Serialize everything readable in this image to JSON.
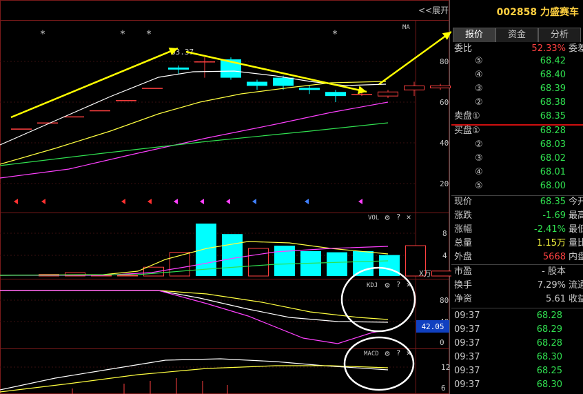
{
  "header": {
    "code": "002858",
    "name": "力盛赛车",
    "expand_label": "<<展开"
  },
  "tabs": [
    "报价",
    "资金",
    "分析"
  ],
  "ratio": {
    "label": "委比",
    "value": "52.33%",
    "tail": "委差"
  },
  "asks": [
    {
      "label": "⑤",
      "price": "68.42"
    },
    {
      "label": "④",
      "price": "68.40"
    },
    {
      "label": "③",
      "price": "68.39"
    },
    {
      "label": "②",
      "price": "68.38"
    },
    {
      "label": "卖盘①",
      "price": "68.35"
    }
  ],
  "bids": [
    {
      "label": "买盘①",
      "price": "68.28"
    },
    {
      "label": "②",
      "price": "68.03"
    },
    {
      "label": "③",
      "price": "68.02"
    },
    {
      "label": "④",
      "price": "68.01"
    },
    {
      "label": "⑤",
      "price": "68.00"
    }
  ],
  "quote": [
    {
      "label": "现价",
      "value": "68.35",
      "tail": "今开",
      "cls": "dn"
    },
    {
      "label": "涨跌",
      "value": "-1.69",
      "tail": "最高",
      "cls": "dn"
    },
    {
      "label": "涨幅",
      "value": "-2.41%",
      "tail": "最低",
      "cls": "dn"
    },
    {
      "label": "总量",
      "value": "1.15万",
      "tail": "量比",
      "cls": "yl"
    },
    {
      "label": "外盘",
      "value": "5668",
      "tail": "内盘",
      "cls": "up"
    }
  ],
  "fund": [
    {
      "label": "市盈",
      "value": "- 股本"
    },
    {
      "label": "换手",
      "value": "7.29%",
      "tail": "流通"
    },
    {
      "label": "净资",
      "value": "5.61",
      "tail": "收益(一"
    }
  ],
  "ticks": [
    {
      "time": "09:37",
      "price": "68.28"
    },
    {
      "time": "09:37",
      "price": "68.29"
    },
    {
      "time": "09:37",
      "price": "68.28"
    },
    {
      "time": "09:37",
      "price": "68.30"
    },
    {
      "time": "09:37",
      "price": "68.25"
    },
    {
      "time": "09:37",
      "price": "68.30"
    }
  ],
  "panels": {
    "main": {
      "indicator": "MA",
      "high_label": "83.37",
      "y_ticks": [
        "80",
        "60",
        "40",
        "20"
      ]
    },
    "vol": {
      "indicator": "VOL",
      "y_ticks": [
        "8",
        "4"
      ],
      "unit": "X万"
    },
    "kdj": {
      "indicator": "KDJ",
      "y_ticks": [
        "80",
        "40",
        "0"
      ],
      "cursor_value": "42.05"
    },
    "macd": {
      "indicator": "MACD",
      "y_ticks": [
        "12",
        "6"
      ]
    }
  },
  "icons": {
    "settings": "⚙",
    "help": "?",
    "close": "✕",
    "star": "*"
  },
  "colors": {
    "up": "#ff4040",
    "down": "#30e050",
    "cyan": "#00ffff",
    "yellow": "#ffff40",
    "magenta": "#ff40ff",
    "annotation_arrow": "#ffff00"
  }
}
